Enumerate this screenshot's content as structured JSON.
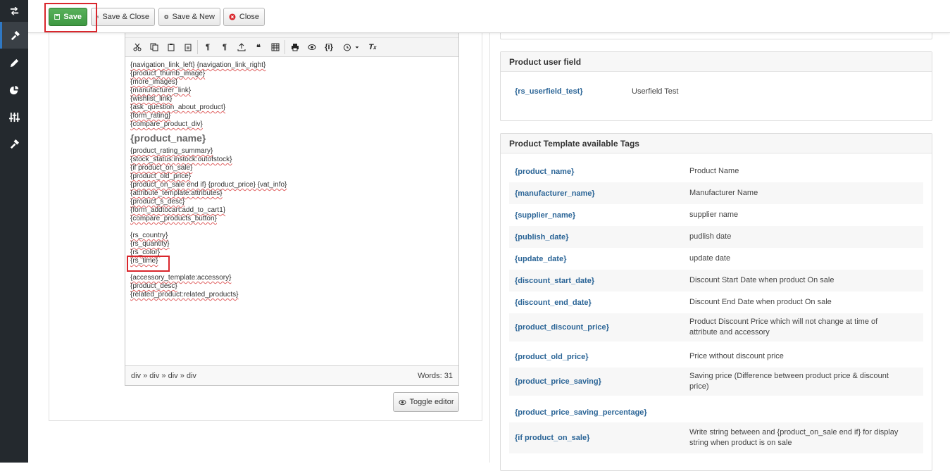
{
  "toolbar": {
    "save_label": "Save",
    "save_close_label": "Save & Close",
    "save_new_label": "Save & New",
    "close_label": "Close"
  },
  "editor": {
    "lines_group1": [
      "{navigation_link_left} {navigation_link_right}",
      "{product_thumb_image}",
      "{more_images}",
      "{manufacturer_link}",
      "{wishlist_link}",
      "{ask_question_about_product}",
      "{form_rating}",
      "{compare_product_div}"
    ],
    "heading": "{product_name}",
    "lines_group2": [
      "{product_rating_summary}",
      "{stock_status:instock:outofstock}",
      "{if product_on_sale}",
      "{product_old_price}",
      "{product_on_sale end if} {product_price} {vat_info}",
      "{attribute_template:attributes}",
      "{product_s_desc}",
      "{form_addtocart:add_to_cart1}",
      "{compare_products_button}"
    ],
    "lines_group3": [
      "{rs_country}",
      "{rs_quantity}",
      "{rs_color}",
      "{rs_time}"
    ],
    "lines_group4": [
      "{accessory_template:accessory}",
      "{product_desc}",
      "{related_product:related_products}"
    ],
    "path": "div » div » div » div",
    "word_count": "Words: 31",
    "toggle_label": "Toggle editor"
  },
  "user_field": {
    "title": "Product user field",
    "tag": "{rs_userfield_test}",
    "value": "Userfield Test"
  },
  "tags_panel": {
    "title": "Product Template available Tags",
    "rows": [
      {
        "tag": "{product_name}",
        "desc": "Product Name"
      },
      {
        "tag": "{manufacturer_name}",
        "desc": "Manufacturer Name"
      },
      {
        "tag": "{supplier_name}",
        "desc": "supplier name"
      },
      {
        "tag": "{publish_date}",
        "desc": "pudlish date"
      },
      {
        "tag": "{update_date}",
        "desc": "update date"
      },
      {
        "tag": "{discount_start_date}",
        "desc": "Discount Start Date when product On sale"
      },
      {
        "tag": "{discount_end_date}",
        "desc": "Discount End Date when product On sale"
      },
      {
        "tag": "{product_discount_price}",
        "desc": "Product Discount Price which will not change at time of attribute and accessory"
      },
      {
        "tag": "{product_old_price}",
        "desc": "Price without discount price"
      },
      {
        "tag": "{product_price_saving}",
        "desc": "Saving price (Difference between product price & discount price)"
      },
      {
        "tag": "{product_price_saving_percentage}",
        "desc": ""
      },
      {
        "tag": "{if product_on_sale}",
        "desc": "Write string between and {product_on_sale end if} for display string when product is on sale"
      }
    ]
  }
}
